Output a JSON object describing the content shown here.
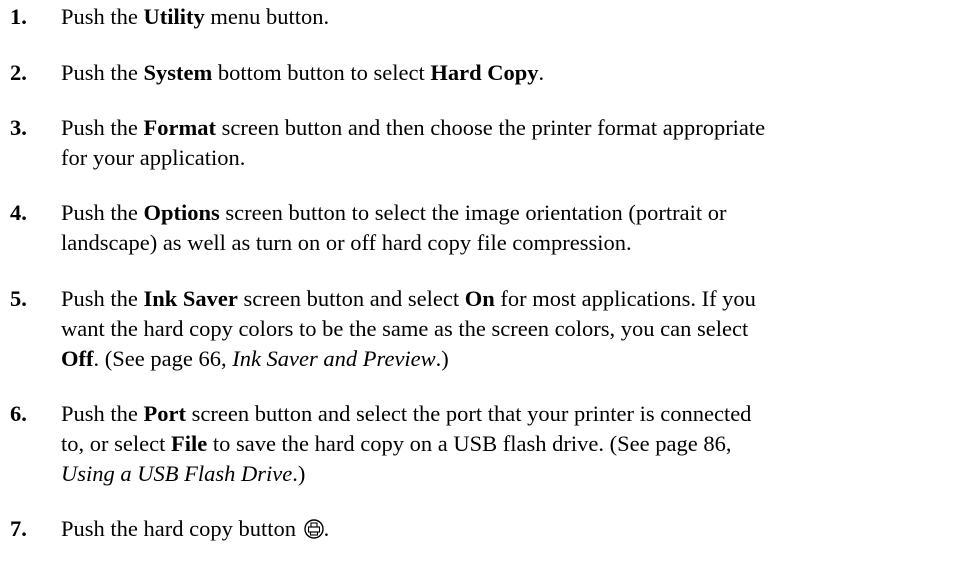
{
  "steps": [
    {
      "number": "1.",
      "lines": [
        [
          {
            "t": "Push the ",
            "s": "n"
          },
          {
            "t": "Utility",
            "s": "b"
          },
          {
            "t": " menu button.",
            "s": "n"
          }
        ]
      ]
    },
    {
      "number": "2.",
      "lines": [
        [
          {
            "t": "Push the ",
            "s": "n"
          },
          {
            "t": "System",
            "s": "b"
          },
          {
            "t": " bottom button to select ",
            "s": "n"
          },
          {
            "t": "Hard Copy",
            "s": "b"
          },
          {
            "t": ".",
            "s": "n"
          }
        ]
      ]
    },
    {
      "number": "3.",
      "lines": [
        [
          {
            "t": "Push the ",
            "s": "n"
          },
          {
            "t": "Format",
            "s": "b"
          },
          {
            "t": " screen button and then choose the printer format appropriate",
            "s": "n"
          }
        ],
        [
          {
            "t": "for your application.",
            "s": "n"
          }
        ]
      ]
    },
    {
      "number": "4.",
      "lines": [
        [
          {
            "t": "Push the ",
            "s": "n"
          },
          {
            "t": "Options",
            "s": "b"
          },
          {
            "t": " screen button to select the image orientation (portrait or",
            "s": "n"
          }
        ],
        [
          {
            "t": "landscape) as well as turn on or off hard copy file compression.",
            "s": "n"
          }
        ]
      ]
    },
    {
      "number": "5.",
      "lines": [
        [
          {
            "t": "Push the ",
            "s": "n"
          },
          {
            "t": "Ink Saver",
            "s": "b"
          },
          {
            "t": " screen button and select ",
            "s": "n"
          },
          {
            "t": "On",
            "s": "b"
          },
          {
            "t": " for most applications. If you",
            "s": "n"
          }
        ],
        [
          {
            "t": "want the hard copy colors to be the same as the screen colors, you can select",
            "s": "n"
          }
        ],
        [
          {
            "t": "Off",
            "s": "b"
          },
          {
            "t": ". (See page 66, ",
            "s": "n"
          },
          {
            "t": "Ink Saver and Preview",
            "s": "i"
          },
          {
            "t": ".)",
            "s": "n"
          }
        ]
      ]
    },
    {
      "number": "6.",
      "lines": [
        [
          {
            "t": "Push the ",
            "s": "n"
          },
          {
            "t": "Port",
            "s": "b"
          },
          {
            "t": " screen button and select the port that your printer is connected",
            "s": "n"
          }
        ],
        [
          {
            "t": "to, or select ",
            "s": "n"
          },
          {
            "t": "File",
            "s": "b"
          },
          {
            "t": " to save the hard copy on a USB flash drive. (See page 86,",
            "s": "n"
          }
        ],
        [
          {
            "t": "Using a USB Flash Drive",
            "s": "i"
          },
          {
            "t": ".)",
            "s": "n"
          }
        ]
      ]
    },
    {
      "number": "7.",
      "lines": [
        [
          {
            "t": "Push the hard copy button ",
            "s": "n"
          },
          {
            "t": "printer-icon",
            "s": "icon"
          },
          {
            "t": ".",
            "s": "n"
          }
        ]
      ]
    }
  ]
}
